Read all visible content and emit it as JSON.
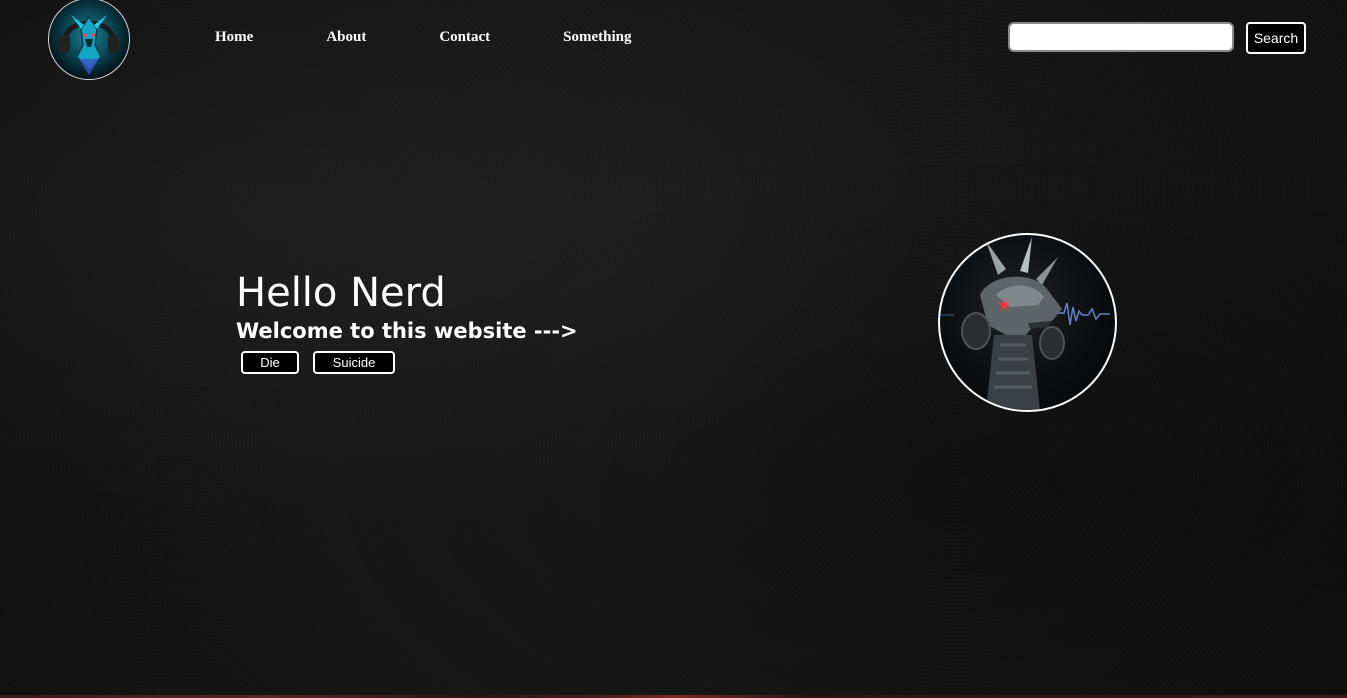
{
  "nav": {
    "logo_alt": "dragon logo",
    "links": [
      {
        "label": "Home"
      },
      {
        "label": "About"
      },
      {
        "label": "Contact"
      },
      {
        "label": "Something"
      }
    ],
    "search": {
      "placeholder": "",
      "value": "",
      "button_label": "Search"
    }
  },
  "hero": {
    "title": "Hello Nerd",
    "subtitle": "Welcome to this website --->",
    "buttons": {
      "die_label": "Die",
      "suicide_label": "Suicide"
    },
    "avatar_alt": "dragon with headphones"
  },
  "colors": {
    "background": "#141414",
    "text": "#ffffff",
    "button_bg": "#000000",
    "button_border": "#ffffff"
  },
  "icons": {
    "logo": "dragon-logo-icon",
    "avatar": "dragon-avatar-image"
  }
}
